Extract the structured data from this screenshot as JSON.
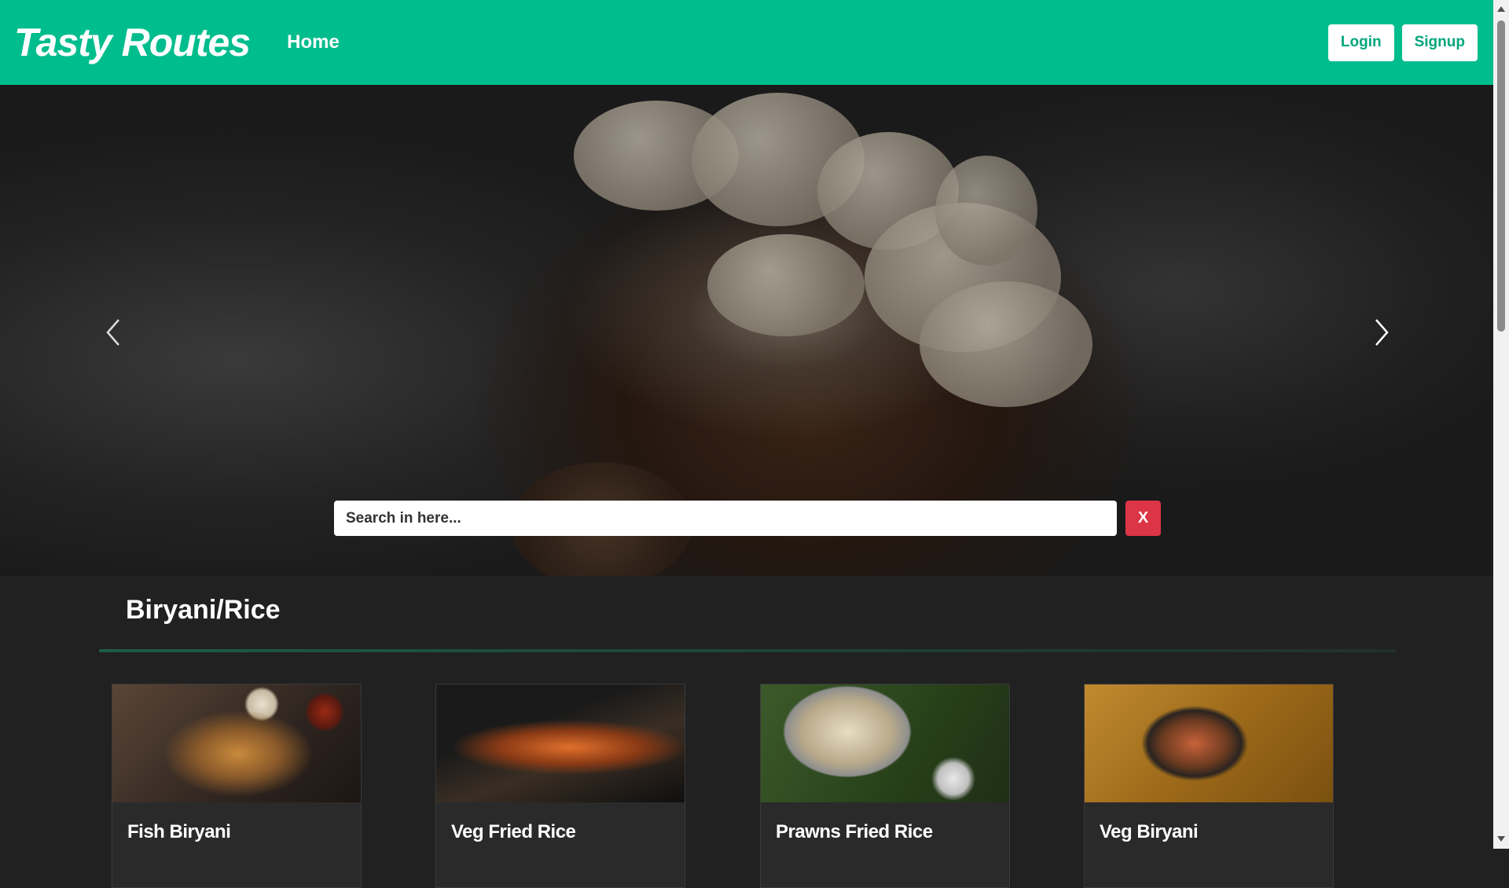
{
  "navbar": {
    "brand": "Tasty Routes",
    "home_label": "Home",
    "login_label": "Login",
    "signup_label": "Signup"
  },
  "hero": {
    "prev_icon": "chevron-left-icon",
    "next_icon": "chevron-right-icon"
  },
  "search": {
    "placeholder": "Search in here...",
    "clear_label": "X"
  },
  "section": {
    "title": "Biryani/Rice"
  },
  "cards": [
    {
      "title": "Fish Biryani"
    },
    {
      "title": "Veg Fried Rice"
    },
    {
      "title": "Prawns Fried Rice"
    },
    {
      "title": "Veg Biryani"
    }
  ],
  "colors": {
    "accent": "#00bd8d",
    "page_bg": "#212121",
    "danger": "#dc3545"
  }
}
